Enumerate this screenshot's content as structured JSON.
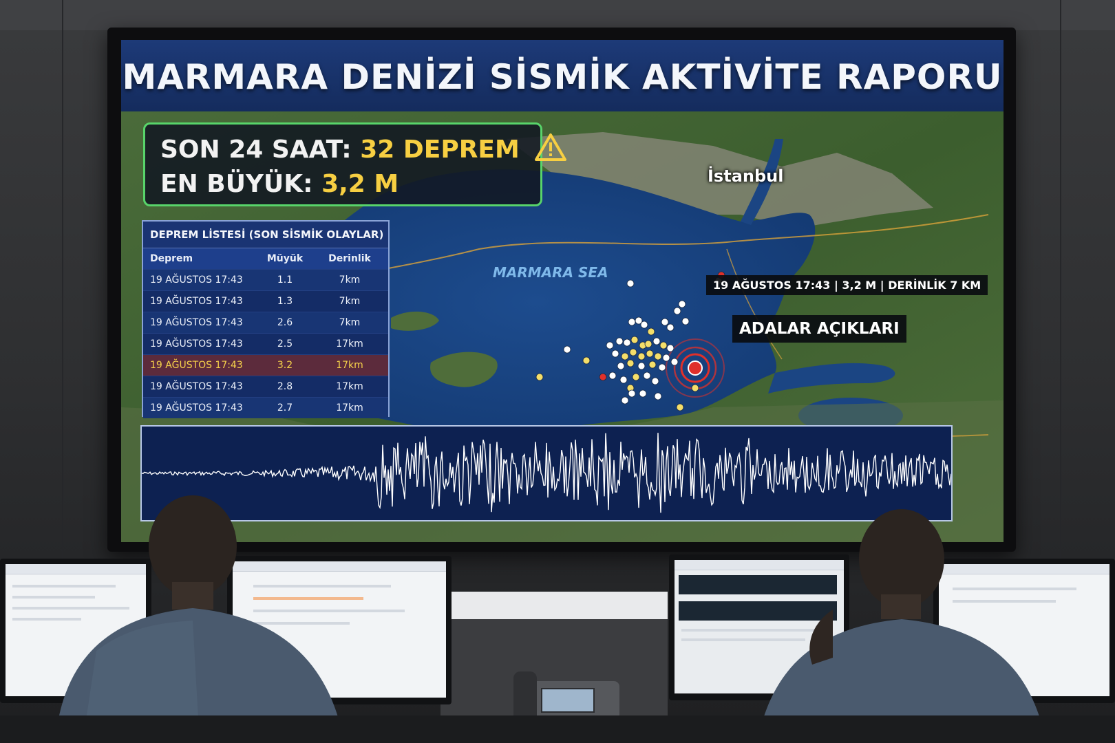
{
  "display": {
    "title": "MARMARA DENİZİ SİSMİK AKTİVİTE RAPORU"
  },
  "summary": {
    "line1_label": "SON 24 SAAT:",
    "line1_value": "32 DEPREM",
    "line2_label": "EN BÜYÜK:",
    "line2_value": "3,2 M",
    "icon": "warning-triangle-icon",
    "accent_color": "#f7cf42",
    "border_color": "#58d46a"
  },
  "eq_list": {
    "title": "DEPREM LİSTESİ (SON SİSMİK OLAYLAR)",
    "columns": [
      "Deprem",
      "Müyük",
      "Derinlik"
    ],
    "rows": [
      {
        "time": "19 AĞUSTOS 17:43",
        "mag": "1.1",
        "depth": "7km"
      },
      {
        "time": "19 AĞUSTOS 17:43",
        "mag": "1.3",
        "depth": "7km"
      },
      {
        "time": "19 AĞUSTOS 17:43",
        "mag": "2.6",
        "depth": "7km"
      },
      {
        "time": "19 AĞUSTOS 17:43",
        "mag": "2.5",
        "depth": "17km"
      },
      {
        "time": "19 AĞUSTOS 17:43",
        "mag": "3.2",
        "depth": "17km"
      },
      {
        "time": "19 AĞUSTOS 17:43",
        "mag": "2.8",
        "depth": "17km"
      },
      {
        "time": "19 AĞUSTOS 17:43",
        "mag": "2.7",
        "depth": "17km"
      }
    ],
    "highlight_color": "#5c2b3c"
  },
  "map": {
    "city_label": "İstanbul",
    "sea_label": "MARMARA SEA",
    "event_tag": "19 AĞUSTOS 17:43 | 3,2 M | DERİNLİK 7 KM",
    "region_tag": "ADALAR AÇIKLARI",
    "marker_colors": {
      "white": "#ffffff",
      "yellow": "#f4de6a",
      "red": "#e0302a"
    }
  },
  "seismogram": {
    "trace_color": "#ffffff"
  }
}
